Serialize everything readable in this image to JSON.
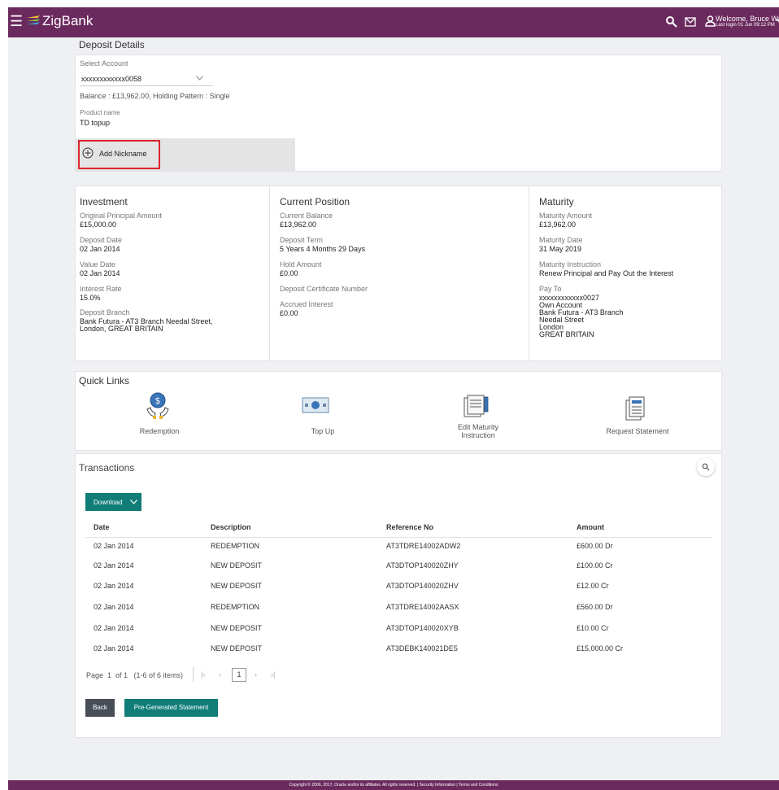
{
  "app": {
    "name": "ZigBank"
  },
  "header": {
    "welcome": "Welcome, Bruce Wayne",
    "last_login": "Last login 01 Jun 09:12 PM"
  },
  "page": {
    "title": "Deposit Details"
  },
  "account": {
    "select_label": "Select Account",
    "selected": "xxxxxxxxxxxx0058",
    "balance_line": "Balance : £13,962.00, Holding Pattern : Single",
    "product_label": "Product name",
    "product_value": "TD topup",
    "add_nickname": "Add Nickname"
  },
  "investment": {
    "heading": "Investment",
    "original_principal_label": "Original Principal Amount",
    "original_principal_value": "£15,000.00",
    "deposit_date_label": "Deposit Date",
    "deposit_date_value": "02 Jan 2014",
    "value_date_label": "Value Date",
    "value_date_value": "02 Jan 2014",
    "interest_rate_label": "Interest Rate",
    "interest_rate_value": "15.0%",
    "branch_label": "Deposit Branch",
    "branch_line1": "Bank Futura - AT3 Branch Needal Street,",
    "branch_line2": "London, GREAT BRITAIN"
  },
  "position": {
    "heading": "Current Position",
    "current_balance_label": "Current Balance",
    "current_balance_value": "£13,962.00",
    "term_label": "Deposit Term",
    "term_value": "5 Years 4 Months 29 Days",
    "hold_label": "Hold Amount",
    "hold_value": "£0.00",
    "certificate_label": "Deposit Certificate Number",
    "accrued_label": "Accrued Interest",
    "accrued_value": "£0.00"
  },
  "maturity": {
    "heading": "Maturity",
    "amount_label": "Maturity Amount",
    "amount_value": "£13,962.00",
    "date_label": "Maturity Date",
    "date_value": "31 May 2019",
    "instruction_label": "Maturity Instruction",
    "instruction_value": "Renew Principal and Pay Out the Interest",
    "pay_to_label": "Pay To",
    "pay_to_account": "xxxxxxxxxxxx0027",
    "pay_to_line1": "Own Account",
    "pay_to_line2": "Bank Futura - AT3 Branch",
    "pay_to_line3": "Needal Street",
    "pay_to_line4": "London",
    "pay_to_line5": "GREAT BRITAIN"
  },
  "quick_links": {
    "heading": "Quick Links",
    "items": [
      {
        "label": "Redemption",
        "icon": "redemption-icon"
      },
      {
        "label": "Top Up",
        "icon": "top-up-icon"
      },
      {
        "label_line1": "Edit Maturity",
        "label_line2": "Instruction",
        "icon": "edit-maturity-icon"
      },
      {
        "label": "Request Statement",
        "icon": "request-statement-icon"
      }
    ]
  },
  "transactions": {
    "heading": "Transactions",
    "download_label": "Download",
    "columns": [
      "Date",
      "Description",
      "Reference No",
      "Amount"
    ],
    "rows": [
      [
        "02 Jan 2014",
        "REDEMPTION",
        "AT3TDRE14002ADW2",
        "£600.00 Dr"
      ],
      [
        "02 Jan 2014",
        "NEW DEPOSIT",
        "AT3DTOP140020ZHY",
        "£100.00 Cr"
      ],
      [
        "02 Jan 2014",
        "NEW DEPOSIT",
        "AT3DTOP140020ZHV",
        "£12.00 Cr"
      ],
      [
        "02 Jan 2014",
        "REDEMPTION",
        "AT3TDRE14002AASX",
        "£560.00 Dr"
      ],
      [
        "02 Jan 2014",
        "NEW DEPOSIT",
        "AT3DTOP140020XYB",
        "£10.00 Cr"
      ],
      [
        "02 Jan 2014",
        "NEW DEPOSIT",
        "AT3DEBK140021DE5",
        "£15,000.00 Cr"
      ]
    ],
    "pager_text": "Page  1  of 1   (1-6 of 6 items)",
    "current_page": "1",
    "back_label": "Back",
    "pregen_label": "Pre-Generated Statement"
  },
  "footer": {
    "text": "Copyright © 2006, 2017, Oracle and/or its affiliates. All rights reserved. | Security Information | Terms and Conditions"
  },
  "colors": {
    "brand": "#6b2a5e",
    "accent": "#107d78",
    "highlight": "#d9262b"
  }
}
